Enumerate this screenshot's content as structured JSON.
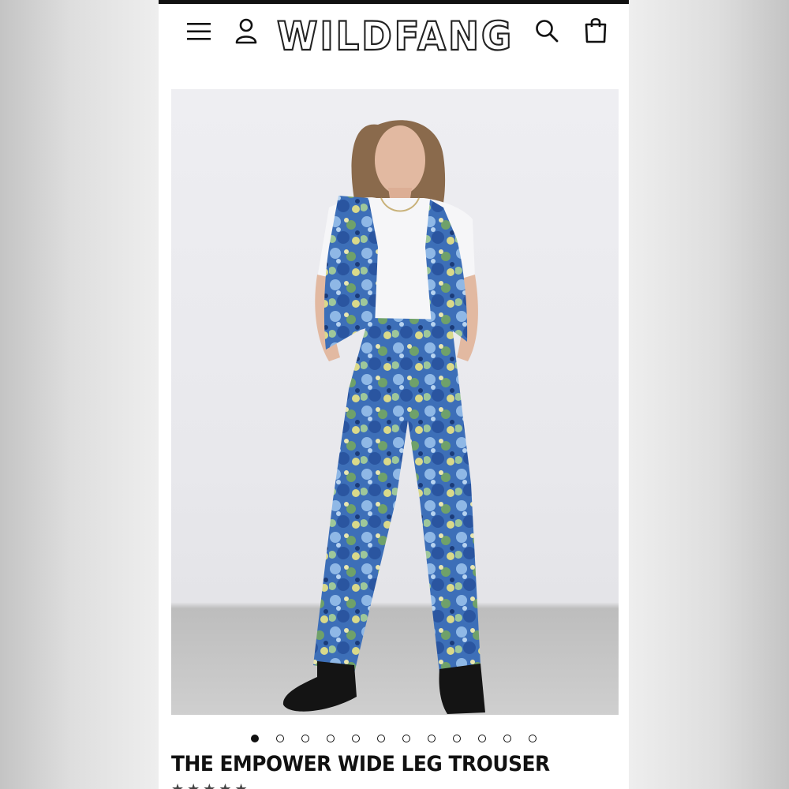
{
  "brand": {
    "logo_text": "WILDFANG"
  },
  "header": {
    "menu_icon": "hamburger-menu-icon",
    "account_icon": "user-icon",
    "search_icon": "search-icon",
    "cart_icon": "shopping-bag-icon"
  },
  "product": {
    "title": "THE EMPOWER WIDE LEG TROUSER",
    "image_alt": "Model wearing blue floral vest and wide leg trousers",
    "gallery": {
      "total_images": 12,
      "active_index": 0
    },
    "rating_stars": "★★★★★"
  },
  "colors": {
    "accent": "#111111",
    "floral_blue": "#3a73c4",
    "floral_green": "#6fa16a",
    "floral_yellow": "#d9d98a"
  }
}
